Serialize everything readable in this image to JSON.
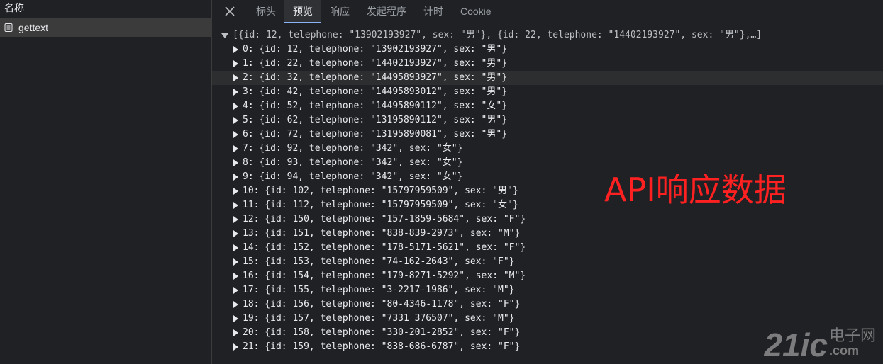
{
  "left_panel": {
    "header": "名称",
    "requests": [
      {
        "name": "gettext",
        "icon": "document-icon"
      }
    ]
  },
  "tabs": {
    "close_icon": "close-icon",
    "items": [
      {
        "label": "标头",
        "active": false
      },
      {
        "label": "预览",
        "active": true
      },
      {
        "label": "响应",
        "active": false
      },
      {
        "label": "发起程序",
        "active": false
      },
      {
        "label": "计时",
        "active": false
      },
      {
        "label": "Cookie",
        "active": false
      }
    ]
  },
  "preview": {
    "summary": "[{id: 12, telephone: \"13902193927\", sex: \"男\"}, {id: 22, telephone: \"14402193927\", sex: \"男\"},…]",
    "rows": [
      {
        "index": "0:",
        "value": "{id: 12, telephone: \"13902193927\", sex: \"男\"}"
      },
      {
        "index": "1:",
        "value": "{id: 22, telephone: \"14402193927\", sex: \"男\"}"
      },
      {
        "index": "2:",
        "value": "{id: 32, telephone: \"14495893927\", sex: \"男\"}"
      },
      {
        "index": "3:",
        "value": "{id: 42, telephone: \"14495893012\", sex: \"男\"}"
      },
      {
        "index": "4:",
        "value": "{id: 52, telephone: \"14495890112\", sex: \"女\"}"
      },
      {
        "index": "5:",
        "value": "{id: 62, telephone: \"13195890112\", sex: \"男\"}"
      },
      {
        "index": "6:",
        "value": "{id: 72, telephone: \"13195890081\", sex: \"男\"}"
      },
      {
        "index": "7:",
        "value": "{id: 92, telephone: \"342\", sex: \"女\"}"
      },
      {
        "index": "8:",
        "value": "{id: 93, telephone: \"342\", sex: \"女\"}"
      },
      {
        "index": "9:",
        "value": "{id: 94, telephone: \"342\", sex: \"女\"}"
      },
      {
        "index": "10:",
        "value": "{id: 102, telephone: \"15797959509\", sex: \"男\"}"
      },
      {
        "index": "11:",
        "value": "{id: 112, telephone: \"15797959509\", sex: \"女\"}"
      },
      {
        "index": "12:",
        "value": "{id: 150, telephone: \"157-1859-5684\", sex: \"F\"}"
      },
      {
        "index": "13:",
        "value": "{id: 151, telephone: \"838-839-2973\", sex: \"M\"}"
      },
      {
        "index": "14:",
        "value": "{id: 152, telephone: \"178-5171-5621\", sex: \"F\"}"
      },
      {
        "index": "15:",
        "value": "{id: 153, telephone: \"74-162-2643\", sex: \"F\"}"
      },
      {
        "index": "16:",
        "value": "{id: 154, telephone: \"179-8271-5292\", sex: \"M\"}"
      },
      {
        "index": "17:",
        "value": "{id: 155, telephone: \"3-2217-1986\", sex: \"M\"}"
      },
      {
        "index": "18:",
        "value": "{id: 156, telephone: \"80-4346-1178\", sex: \"F\"}"
      },
      {
        "index": "19:",
        "value": "{id: 157, telephone: \"7331 376507\", sex: \"M\"}"
      },
      {
        "index": "20:",
        "value": "{id: 158, telephone: \"330-201-2852\", sex: \"F\"}"
      },
      {
        "index": "21:",
        "value": "{id: 159, telephone: \"838-686-6787\", sex: \"F\"}"
      }
    ]
  },
  "annotation": "API响应数据",
  "watermark": {
    "big": "21ic",
    "cn": "电子网",
    "com": ".com"
  },
  "colors": {
    "annotation": "#ff2121",
    "active_tab_underline": "#8ab4f8",
    "background": "#202124"
  }
}
